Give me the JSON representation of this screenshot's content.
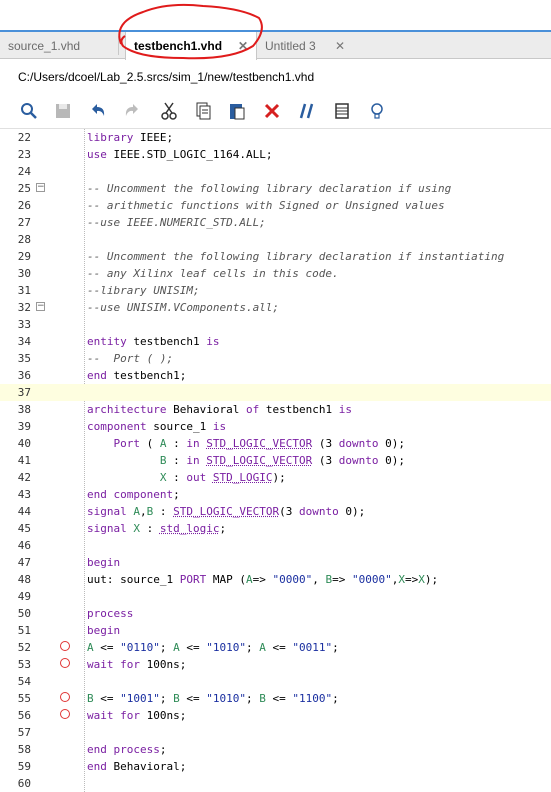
{
  "tabs": [
    {
      "label": "source_1.vhd",
      "active": false
    },
    {
      "label": "testbench1.vhd",
      "active": true
    },
    {
      "label": "Untitled 3",
      "active": false
    }
  ],
  "file_path": "C:/Users/dcoel/Lab_2.5.srcs/sim_1/new/testbench1.vhd",
  "toolbar": [
    "search-icon",
    "save-icon",
    "undo-icon",
    "redo-icon",
    "cut-icon",
    "copy-icon",
    "paste-icon",
    "delete-icon",
    "comment-icon",
    "block-icon",
    "lightbulb-icon"
  ],
  "lines": [
    {
      "n": "22",
      "t": "library IEEE;"
    },
    {
      "n": "23",
      "t": "use IEEE.STD_LOGIC_1164.ALL;"
    },
    {
      "n": "24",
      "t": ""
    },
    {
      "n": "25",
      "t": "-- Uncomment the following library declaration if using"
    },
    {
      "n": "26",
      "t": "-- arithmetic functions with Signed or Unsigned values"
    },
    {
      "n": "27",
      "t": "--use IEEE.NUMERIC_STD.ALL;"
    },
    {
      "n": "28",
      "t": ""
    },
    {
      "n": "29",
      "t": "-- Uncomment the following library declaration if instantiating"
    },
    {
      "n": "30",
      "t": "-- any Xilinx leaf cells in this code."
    },
    {
      "n": "31",
      "t": "--library UNISIM;"
    },
    {
      "n": "32",
      "t": "--use UNISIM.VComponents.all;"
    },
    {
      "n": "33",
      "t": ""
    },
    {
      "n": "34",
      "t": "entity testbench1 is"
    },
    {
      "n": "35",
      "t": "--  Port ( );"
    },
    {
      "n": "36",
      "t": "end testbench1;"
    },
    {
      "n": "37",
      "t": ""
    },
    {
      "n": "38",
      "t": "architecture Behavioral of testbench1 is"
    },
    {
      "n": "39",
      "t": "component source_1 is"
    },
    {
      "n": "40",
      "t": "    Port ( A : in STD_LOGIC_VECTOR (3 downto 0);"
    },
    {
      "n": "41",
      "t": "           B : in STD_LOGIC_VECTOR (3 downto 0);"
    },
    {
      "n": "42",
      "t": "           X : out STD_LOGIC);"
    },
    {
      "n": "43",
      "t": "end component;"
    },
    {
      "n": "44",
      "t": "signal A,B : STD_LOGIC_VECTOR(3 downto 0);"
    },
    {
      "n": "45",
      "t": "signal X : std_logic;"
    },
    {
      "n": "46",
      "t": ""
    },
    {
      "n": "47",
      "t": "begin"
    },
    {
      "n": "48",
      "t": "uut: source_1 PORT MAP (A=> \"0000\", B=> \"0000\",X=>X);"
    },
    {
      "n": "49",
      "t": ""
    },
    {
      "n": "50",
      "t": "process"
    },
    {
      "n": "51",
      "t": "begin"
    },
    {
      "n": "52",
      "t": "A <= \"0110\"; A <= \"1010\"; A <= \"0011\";"
    },
    {
      "n": "53",
      "t": "wait for 100ns;"
    },
    {
      "n": "54",
      "t": ""
    },
    {
      "n": "55",
      "t": "B <= \"1001\"; B <= \"1010\"; B <= \"1100\";"
    },
    {
      "n": "56",
      "t": "wait for 100ns;"
    },
    {
      "n": "57",
      "t": ""
    },
    {
      "n": "58",
      "t": "end process;"
    },
    {
      "n": "59",
      "t": "end Behavioral;"
    },
    {
      "n": "60",
      "t": ""
    }
  ],
  "breakpoint_lines": [
    "52",
    "53",
    "55",
    "56"
  ],
  "fold_lines": [
    "25",
    "32"
  ],
  "highlight_line": "37",
  "annotation_color": "#e01b1b"
}
